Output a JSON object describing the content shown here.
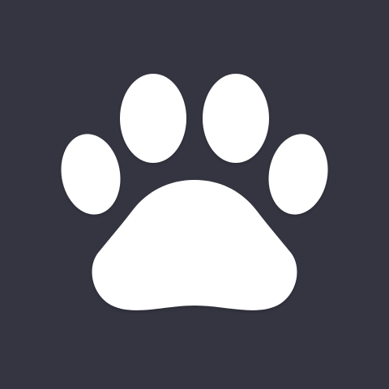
{
  "icon": {
    "name": "paw-icon",
    "background_color": "#353542",
    "foreground_color": "#FFFFFF"
  }
}
